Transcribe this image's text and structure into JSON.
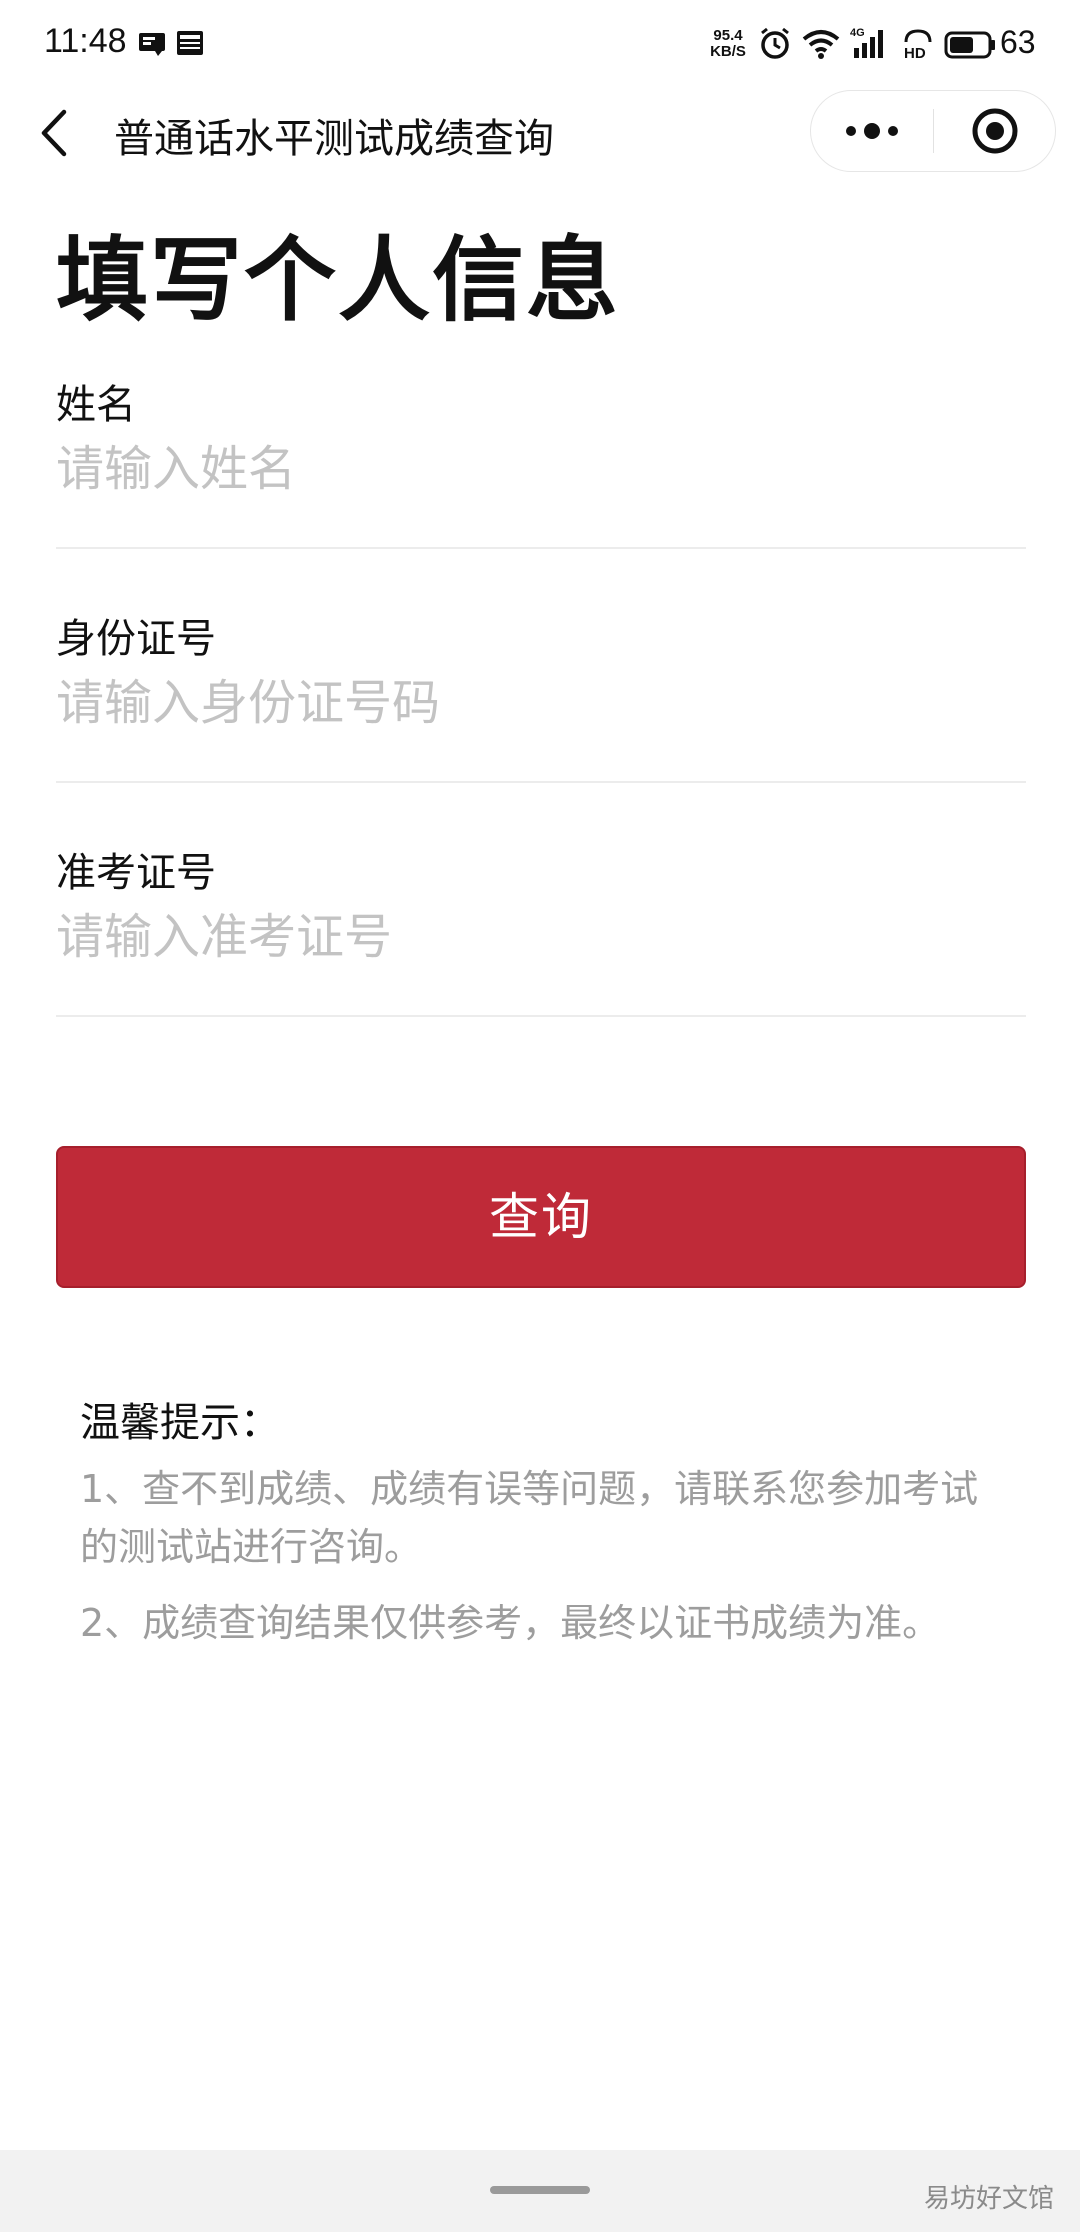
{
  "status_bar": {
    "time": "11:48",
    "net_speed_value": "95.4",
    "net_speed_unit": "KB/S",
    "network_type": "4G",
    "hd_label": "HD",
    "battery": "63",
    "battery_level": 0.63,
    "icons": [
      "notification-icon",
      "news-icon",
      "alarm-icon",
      "wifi-icon",
      "signal-icon",
      "hd-icon",
      "battery-icon"
    ]
  },
  "nav": {
    "title": "普通话水平测试成绩查询",
    "back_icon": "chevron-left-icon",
    "more_icon": "more-dots-icon",
    "close_icon": "target-circle-icon"
  },
  "page": {
    "heading": "填写个人信息"
  },
  "form": {
    "name": {
      "label": "姓名",
      "placeholder": "请输入姓名",
      "value": ""
    },
    "id_number": {
      "label": "身份证号",
      "placeholder": "请输入身份证号码",
      "value": ""
    },
    "ticket_number": {
      "label": "准考证号",
      "placeholder": "请输入准考证号",
      "value": ""
    },
    "submit_label": "查询"
  },
  "tips": {
    "title": "温馨提示：",
    "items": [
      "1、查不到成绩、成绩有误等问题，请联系您参加考试的测试站进行咨询。",
      "2、成绩查询结果仅供参考，最终以证书成绩为准。"
    ]
  },
  "footer": {
    "watermark": "易坊好文馆"
  },
  "colors": {
    "accent": "#bf2a38",
    "placeholder": "#c3c3c3",
    "tip_text": "#9d9d9d",
    "divider": "#ececec"
  }
}
